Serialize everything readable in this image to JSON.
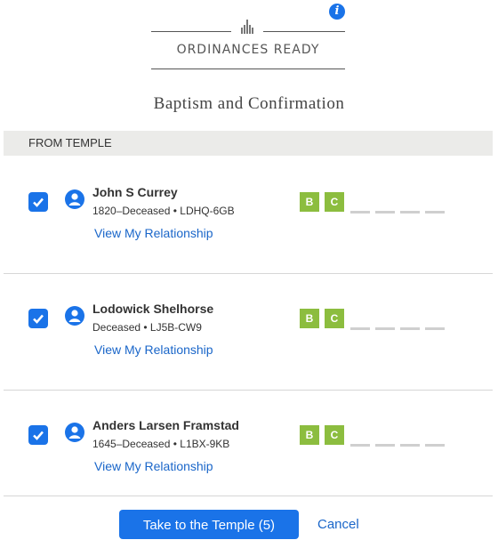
{
  "header": {
    "title": "ORDINANCES READY",
    "subtitle": "Baptism and Confirmation",
    "info_icon": "info-icon",
    "temple_icon": "temple-icon"
  },
  "section": {
    "label": "FROM TEMPLE"
  },
  "people": [
    {
      "name": "John S Currey",
      "meta": "1820–Deceased • LDHQ-6GB",
      "link": "View My Relationship",
      "checked": true,
      "ordinances": [
        {
          "label": "B"
        },
        {
          "label": "C"
        }
      ],
      "pending_count": 4
    },
    {
      "name": "Lodowick Shelhorse",
      "meta": "Deceased • LJ5B-CW9",
      "link": "View My Relationship",
      "checked": true,
      "ordinances": [
        {
          "label": "B"
        },
        {
          "label": "C"
        }
      ],
      "pending_count": 4
    },
    {
      "name": "Anders Larsen Framstad",
      "meta": "1645–Deceased • L1BX-9KB",
      "link": "View My Relationship",
      "checked": true,
      "ordinances": [
        {
          "label": "B"
        },
        {
          "label": "C"
        }
      ],
      "pending_count": 4
    }
  ],
  "footer": {
    "primary_button": "Take to the Temple (5)",
    "cancel": "Cancel"
  },
  "colors": {
    "accent": "#1a73e8",
    "link": "#1a66c9",
    "ordinance_done": "#8cbd3f",
    "section_bg": "#ebebe9"
  }
}
